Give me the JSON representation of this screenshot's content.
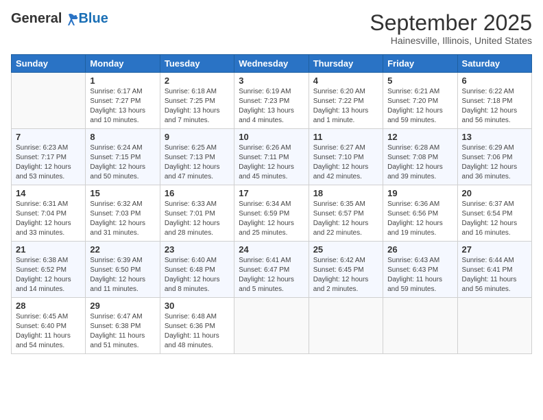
{
  "header": {
    "logo_general": "General",
    "logo_blue": "Blue",
    "title": "September 2025",
    "subtitle": "Hainesville, Illinois, United States"
  },
  "weekdays": [
    "Sunday",
    "Monday",
    "Tuesday",
    "Wednesday",
    "Thursday",
    "Friday",
    "Saturday"
  ],
  "weeks": [
    [
      {
        "day": "",
        "info": ""
      },
      {
        "day": "1",
        "info": "Sunrise: 6:17 AM\nSunset: 7:27 PM\nDaylight: 13 hours\nand 10 minutes."
      },
      {
        "day": "2",
        "info": "Sunrise: 6:18 AM\nSunset: 7:25 PM\nDaylight: 13 hours\nand 7 minutes."
      },
      {
        "day": "3",
        "info": "Sunrise: 6:19 AM\nSunset: 7:23 PM\nDaylight: 13 hours\nand 4 minutes."
      },
      {
        "day": "4",
        "info": "Sunrise: 6:20 AM\nSunset: 7:22 PM\nDaylight: 13 hours\nand 1 minute."
      },
      {
        "day": "5",
        "info": "Sunrise: 6:21 AM\nSunset: 7:20 PM\nDaylight: 12 hours\nand 59 minutes."
      },
      {
        "day": "6",
        "info": "Sunrise: 6:22 AM\nSunset: 7:18 PM\nDaylight: 12 hours\nand 56 minutes."
      }
    ],
    [
      {
        "day": "7",
        "info": "Sunrise: 6:23 AM\nSunset: 7:17 PM\nDaylight: 12 hours\nand 53 minutes."
      },
      {
        "day": "8",
        "info": "Sunrise: 6:24 AM\nSunset: 7:15 PM\nDaylight: 12 hours\nand 50 minutes."
      },
      {
        "day": "9",
        "info": "Sunrise: 6:25 AM\nSunset: 7:13 PM\nDaylight: 12 hours\nand 47 minutes."
      },
      {
        "day": "10",
        "info": "Sunrise: 6:26 AM\nSunset: 7:11 PM\nDaylight: 12 hours\nand 45 minutes."
      },
      {
        "day": "11",
        "info": "Sunrise: 6:27 AM\nSunset: 7:10 PM\nDaylight: 12 hours\nand 42 minutes."
      },
      {
        "day": "12",
        "info": "Sunrise: 6:28 AM\nSunset: 7:08 PM\nDaylight: 12 hours\nand 39 minutes."
      },
      {
        "day": "13",
        "info": "Sunrise: 6:29 AM\nSunset: 7:06 PM\nDaylight: 12 hours\nand 36 minutes."
      }
    ],
    [
      {
        "day": "14",
        "info": "Sunrise: 6:31 AM\nSunset: 7:04 PM\nDaylight: 12 hours\nand 33 minutes."
      },
      {
        "day": "15",
        "info": "Sunrise: 6:32 AM\nSunset: 7:03 PM\nDaylight: 12 hours\nand 31 minutes."
      },
      {
        "day": "16",
        "info": "Sunrise: 6:33 AM\nSunset: 7:01 PM\nDaylight: 12 hours\nand 28 minutes."
      },
      {
        "day": "17",
        "info": "Sunrise: 6:34 AM\nSunset: 6:59 PM\nDaylight: 12 hours\nand 25 minutes."
      },
      {
        "day": "18",
        "info": "Sunrise: 6:35 AM\nSunset: 6:57 PM\nDaylight: 12 hours\nand 22 minutes."
      },
      {
        "day": "19",
        "info": "Sunrise: 6:36 AM\nSunset: 6:56 PM\nDaylight: 12 hours\nand 19 minutes."
      },
      {
        "day": "20",
        "info": "Sunrise: 6:37 AM\nSunset: 6:54 PM\nDaylight: 12 hours\nand 16 minutes."
      }
    ],
    [
      {
        "day": "21",
        "info": "Sunrise: 6:38 AM\nSunset: 6:52 PM\nDaylight: 12 hours\nand 14 minutes."
      },
      {
        "day": "22",
        "info": "Sunrise: 6:39 AM\nSunset: 6:50 PM\nDaylight: 12 hours\nand 11 minutes."
      },
      {
        "day": "23",
        "info": "Sunrise: 6:40 AM\nSunset: 6:48 PM\nDaylight: 12 hours\nand 8 minutes."
      },
      {
        "day": "24",
        "info": "Sunrise: 6:41 AM\nSunset: 6:47 PM\nDaylight: 12 hours\nand 5 minutes."
      },
      {
        "day": "25",
        "info": "Sunrise: 6:42 AM\nSunset: 6:45 PM\nDaylight: 12 hours\nand 2 minutes."
      },
      {
        "day": "26",
        "info": "Sunrise: 6:43 AM\nSunset: 6:43 PM\nDaylight: 11 hours\nand 59 minutes."
      },
      {
        "day": "27",
        "info": "Sunrise: 6:44 AM\nSunset: 6:41 PM\nDaylight: 11 hours\nand 56 minutes."
      }
    ],
    [
      {
        "day": "28",
        "info": "Sunrise: 6:45 AM\nSunset: 6:40 PM\nDaylight: 11 hours\nand 54 minutes."
      },
      {
        "day": "29",
        "info": "Sunrise: 6:47 AM\nSunset: 6:38 PM\nDaylight: 11 hours\nand 51 minutes."
      },
      {
        "day": "30",
        "info": "Sunrise: 6:48 AM\nSunset: 6:36 PM\nDaylight: 11 hours\nand 48 minutes."
      },
      {
        "day": "",
        "info": ""
      },
      {
        "day": "",
        "info": ""
      },
      {
        "day": "",
        "info": ""
      },
      {
        "day": "",
        "info": ""
      }
    ]
  ]
}
